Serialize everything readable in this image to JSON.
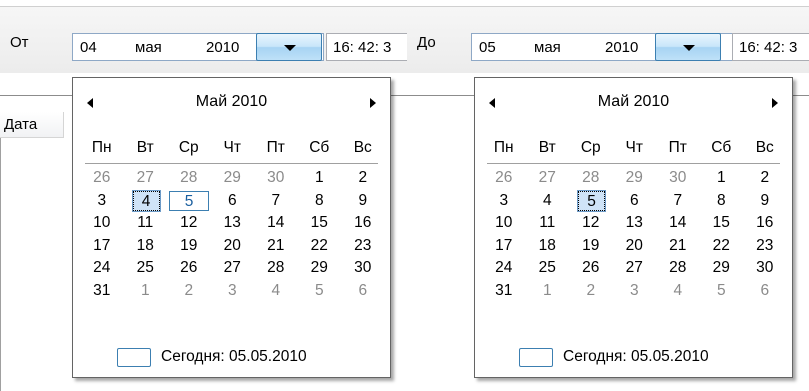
{
  "left": {
    "label": "От",
    "date": {
      "day": "04",
      "month": "мая",
      "year": "2010"
    },
    "time": "16: 42: 3",
    "column_header": "Дата",
    "calendar": {
      "title": "Май 2010",
      "weekdays": [
        "Пн",
        "Вт",
        "Ср",
        "Чт",
        "Пт",
        "Сб",
        "Вс"
      ],
      "weeks": [
        [
          "26",
          "27",
          "28",
          "29",
          "30",
          "1",
          "2"
        ],
        [
          "3",
          "4",
          "5",
          "6",
          "7",
          "8",
          "9"
        ],
        [
          "10",
          "11",
          "12",
          "13",
          "14",
          "15",
          "16"
        ],
        [
          "17",
          "18",
          "19",
          "20",
          "21",
          "22",
          "23"
        ],
        [
          "24",
          "25",
          "26",
          "27",
          "28",
          "29",
          "30"
        ],
        [
          "31",
          "1",
          "2",
          "3",
          "4",
          "5",
          "6"
        ]
      ],
      "selected_day": "4",
      "today_day": "5",
      "today_text": "Сегодня: 05.05.2010"
    }
  },
  "right": {
    "label": "До",
    "date": {
      "day": "05",
      "month": "мая",
      "year": "2010"
    },
    "time": "16: 42: 3",
    "calendar": {
      "title": "Май 2010",
      "weekdays": [
        "Пн",
        "Вт",
        "Ср",
        "Чт",
        "Пт",
        "Сб",
        "Вс"
      ],
      "weeks": [
        [
          "26",
          "27",
          "28",
          "29",
          "30",
          "1",
          "2"
        ],
        [
          "3",
          "4",
          "5",
          "6",
          "7",
          "8",
          "9"
        ],
        [
          "10",
          "11",
          "12",
          "13",
          "14",
          "15",
          "16"
        ],
        [
          "17",
          "18",
          "19",
          "20",
          "21",
          "22",
          "23"
        ],
        [
          "24",
          "25",
          "26",
          "27",
          "28",
          "29",
          "30"
        ],
        [
          "31",
          "1",
          "2",
          "3",
          "4",
          "5",
          "6"
        ]
      ],
      "selected_day": "5",
      "today_day": "5",
      "today_text": "Сегодня: 05.05.2010"
    }
  },
  "colors": {
    "accent": "#3c7fb1",
    "selected_bg": "#cfe3f7",
    "muted": "#8b8b8b"
  },
  "icons": {
    "prev": "chevron-left-icon",
    "next": "chevron-right-icon",
    "dropdown": "caret-down-icon"
  }
}
